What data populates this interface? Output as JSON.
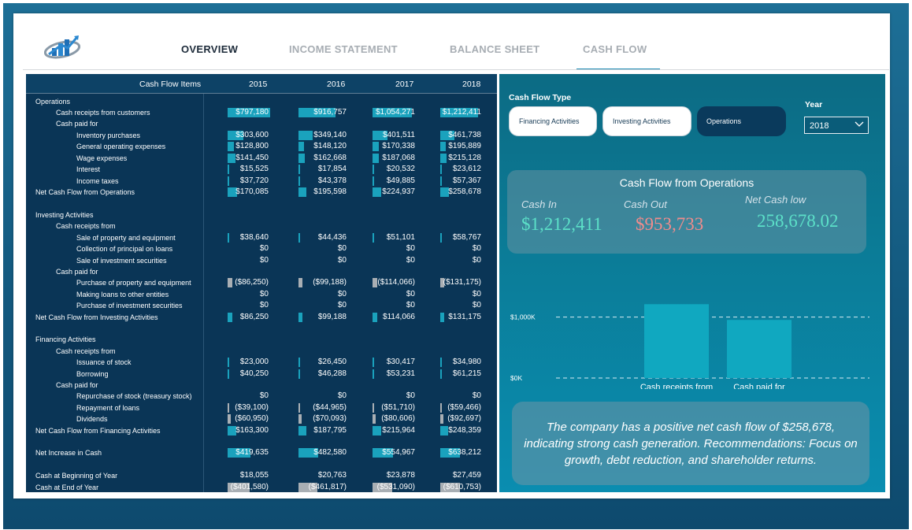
{
  "nav": {
    "tabs": [
      {
        "label": "OVERVIEW",
        "active": true
      },
      {
        "label": "INCOME STATEMENT",
        "active": false
      },
      {
        "label": "BALANCE SHEET",
        "active": false
      },
      {
        "label": "CASH FLOW",
        "active": false
      }
    ]
  },
  "logo": {
    "icon": "bar-chart-logo-icon"
  },
  "table": {
    "header": {
      "label": "Cash Flow Items",
      "years": [
        "2015",
        "2016",
        "2017",
        "2018"
      ]
    },
    "rows": [
      {
        "label": "Operations",
        "indent": 0,
        "y": 130
      },
      {
        "label": "Cash receipts from customers",
        "indent": 1,
        "y": 144,
        "values": [
          "$797,180",
          "$916,757",
          "$1,054,271",
          "$1,212,411"
        ],
        "bars": [
          0.45,
          0.39,
          0.42,
          0.4
        ],
        "bar_color": "#1aa2bd"
      },
      {
        "label": "Cash paid for",
        "indent": 1,
        "y": 158
      },
      {
        "label": "Inventory purchases",
        "indent": 2,
        "y": 173,
        "values": [
          "$303,600",
          "$349,140",
          "$401,511",
          "$461,738"
        ],
        "bars": [
          0.17,
          0.15,
          0.16,
          0.15
        ],
        "bar_color": "#1aa2bd"
      },
      {
        "label": "General operating expenses",
        "indent": 2,
        "y": 187,
        "values": [
          "$128,800",
          "$148,120",
          "$170,338",
          "$195,889"
        ],
        "bars": [
          0.07,
          0.06,
          0.07,
          0.06
        ],
        "bar_color": "#1aa2bd"
      },
      {
        "label": "Wage expenses",
        "indent": 2,
        "y": 202,
        "values": [
          "$141,450",
          "$162,668",
          "$187,068",
          "$215,128"
        ],
        "bars": [
          0.08,
          0.07,
          0.07,
          0.07
        ],
        "bar_color": "#1aa2bd"
      },
      {
        "label": "Interest",
        "indent": 2,
        "y": 216,
        "values": [
          "$15,525",
          "$17,854",
          "$20,532",
          "$23,612"
        ],
        "bars": [
          0.01,
          0.01,
          0.01,
          0.01
        ],
        "bar_color": "#1aa2bd"
      },
      {
        "label": "Income taxes",
        "indent": 2,
        "y": 231,
        "values": [
          "$37,720",
          "$43,378",
          "$49,885",
          "$57,367"
        ],
        "bars": [
          0.02,
          0.02,
          0.02,
          0.02
        ],
        "bar_color": "#1aa2bd"
      },
      {
        "label": "Net Cash Flow from Operations",
        "indent": 0,
        "y": 245,
        "values": [
          "$170,085",
          "$195,598",
          "$224,937",
          "$258,678"
        ],
        "bars": [
          0.1,
          0.08,
          0.09,
          0.09
        ],
        "bar_color": "#1aa2bd"
      },
      {
        "label": "Investing Activities",
        "indent": 0,
        "y": 274
      },
      {
        "label": "Cash receipts from",
        "indent": 1,
        "y": 288
      },
      {
        "label": "Sale of property and equipment",
        "indent": 2,
        "y": 303,
        "values": [
          "$38,640",
          "$44,436",
          "$51,101",
          "$58,767"
        ],
        "bars": [
          0.02,
          0.02,
          0.02,
          0.02
        ],
        "bar_color": "#1aa2bd"
      },
      {
        "label": "Collection of principal on loans",
        "indent": 2,
        "y": 317,
        "values": [
          "$0",
          "$0",
          "$0",
          "$0"
        ]
      },
      {
        "label": "Sale of investment securities",
        "indent": 2,
        "y": 332,
        "values": [
          "$0",
          "$0",
          "$0",
          "$0"
        ]
      },
      {
        "label": "Cash paid for",
        "indent": 1,
        "y": 346
      },
      {
        "label": "Purchase of property and equipment",
        "indent": 2,
        "y": 360,
        "values": [
          "($86,250)",
          "($99,188)",
          "($114,066)",
          "($131,175)"
        ],
        "bars": [
          0.05,
          0.04,
          0.05,
          0.04
        ],
        "bar_color": "#a9afb4"
      },
      {
        "label": "Making loans to other entities",
        "indent": 2,
        "y": 375,
        "values": [
          "$0",
          "$0",
          "$0",
          "$0"
        ]
      },
      {
        "label": "Purchase of investment securities",
        "indent": 2,
        "y": 389,
        "values": [
          "$0",
          "$0",
          "$0",
          "$0"
        ]
      },
      {
        "label": "Net Cash Flow from Investing Activities",
        "indent": 0,
        "y": 404,
        "values": [
          "$86,250",
          "$99,188",
          "$114,066",
          "$131,175"
        ],
        "bars": [
          0.05,
          0.04,
          0.05,
          0.04
        ],
        "bar_color": "#1aa2bd"
      },
      {
        "label": "Financing Activities",
        "indent": 0,
        "y": 432
      },
      {
        "label": "Cash receipts from",
        "indent": 1,
        "y": 447
      },
      {
        "label": "Issuance of stock",
        "indent": 2,
        "y": 461,
        "values": [
          "$23,000",
          "$26,450",
          "$30,417",
          "$34,980"
        ],
        "bars": [
          0.01,
          0.01,
          0.01,
          0.01
        ],
        "bar_color": "#1aa2bd"
      },
      {
        "label": "Borrowing",
        "indent": 2,
        "y": 476,
        "values": [
          "$40,250",
          "$46,288",
          "$53,231",
          "$61,215"
        ],
        "bars": [
          0.02,
          0.02,
          0.02,
          0.02
        ],
        "bar_color": "#1aa2bd"
      },
      {
        "label": "Cash paid for",
        "indent": 1,
        "y": 490
      },
      {
        "label": "Repurchase of stock (treasury stock)",
        "indent": 2,
        "y": 504,
        "values": [
          "$0",
          "$0",
          "$0",
          "$0"
        ]
      },
      {
        "label": "Repayment of loans",
        "indent": 2,
        "y": 519,
        "values": [
          "($39,100)",
          "($44,965)",
          "($51,710)",
          "($59,466)"
        ],
        "bars": [
          0.02,
          0.02,
          0.02,
          0.02
        ],
        "bar_color": "#a9afb4"
      },
      {
        "label": "Dividends",
        "indent": 2,
        "y": 533,
        "values": [
          "($60,950)",
          "($70,093)",
          "($80,606)",
          "($92,697)"
        ],
        "bars": [
          0.03,
          0.03,
          0.03,
          0.03
        ],
        "bar_color": "#a9afb4"
      },
      {
        "label": "Net Cash Flow from Financing Activities",
        "indent": 0,
        "y": 548,
        "values": [
          "$163,300",
          "$187,795",
          "$215,964",
          "$248,359"
        ],
        "bars": [
          0.09,
          0.08,
          0.09,
          0.08
        ],
        "bar_color": "#1aa2bd"
      },
      {
        "label": "Net Increase in Cash",
        "indent": 0,
        "y": 576,
        "values": [
          "$419,635",
          "$482,580",
          "$554,967",
          "$638,212"
        ],
        "bars": [
          0.24,
          0.21,
          0.22,
          0.21
        ],
        "bar_color": "#1aa2bd"
      },
      {
        "label": "Cash at Beginning of Year",
        "indent": 0,
        "y": 605,
        "values": [
          "$18,055",
          "$20,763",
          "$23,878",
          "$27,459"
        ]
      },
      {
        "label": "Cash at End of Year",
        "indent": 0,
        "y": 620,
        "values": [
          "($401,580)",
          "($461,817)",
          "($531,090)",
          "($610,753)"
        ],
        "bars": [
          0.23,
          0.2,
          0.21,
          0.21
        ],
        "bar_color": "#a9afb4"
      }
    ]
  },
  "filters": {
    "cash_flow_type_label": "Cash Flow Type",
    "options": [
      "Financing Activities",
      "Investing Activities",
      "Operations"
    ],
    "selected": "Operations",
    "year_label": "Year",
    "year_value": "2018",
    "year_icon": "chevron-down-icon"
  },
  "kpi": {
    "title": "Cash Flow from Operations",
    "cash_in_label": "Cash In",
    "cash_in_value": "$1,212,411",
    "cash_out_label": "Cash Out",
    "cash_out_value": "$953,733",
    "net_label": "Net Cash low",
    "net_value": "258,678.02",
    "colors": {
      "cash_in": "#5ce0c8",
      "cash_out": "#f08c8c",
      "net": "#5ce0c8"
    }
  },
  "chart_data": {
    "type": "bar",
    "categories": [
      "Cash receipts from",
      "Cash paid for"
    ],
    "values": [
      1212411,
      953733
    ],
    "tick_labels": [
      "$0K",
      "$1,000K"
    ],
    "ticks": [
      0,
      1000000
    ],
    "ylim": [
      0,
      1500000
    ],
    "bar_color": "#10a8c0",
    "grid": true
  },
  "recommendation": "The company has a positive net cash flow of $258,678, indicating strong cash generation. Recommendations: Focus on growth, debt reduction, and shareholder returns."
}
